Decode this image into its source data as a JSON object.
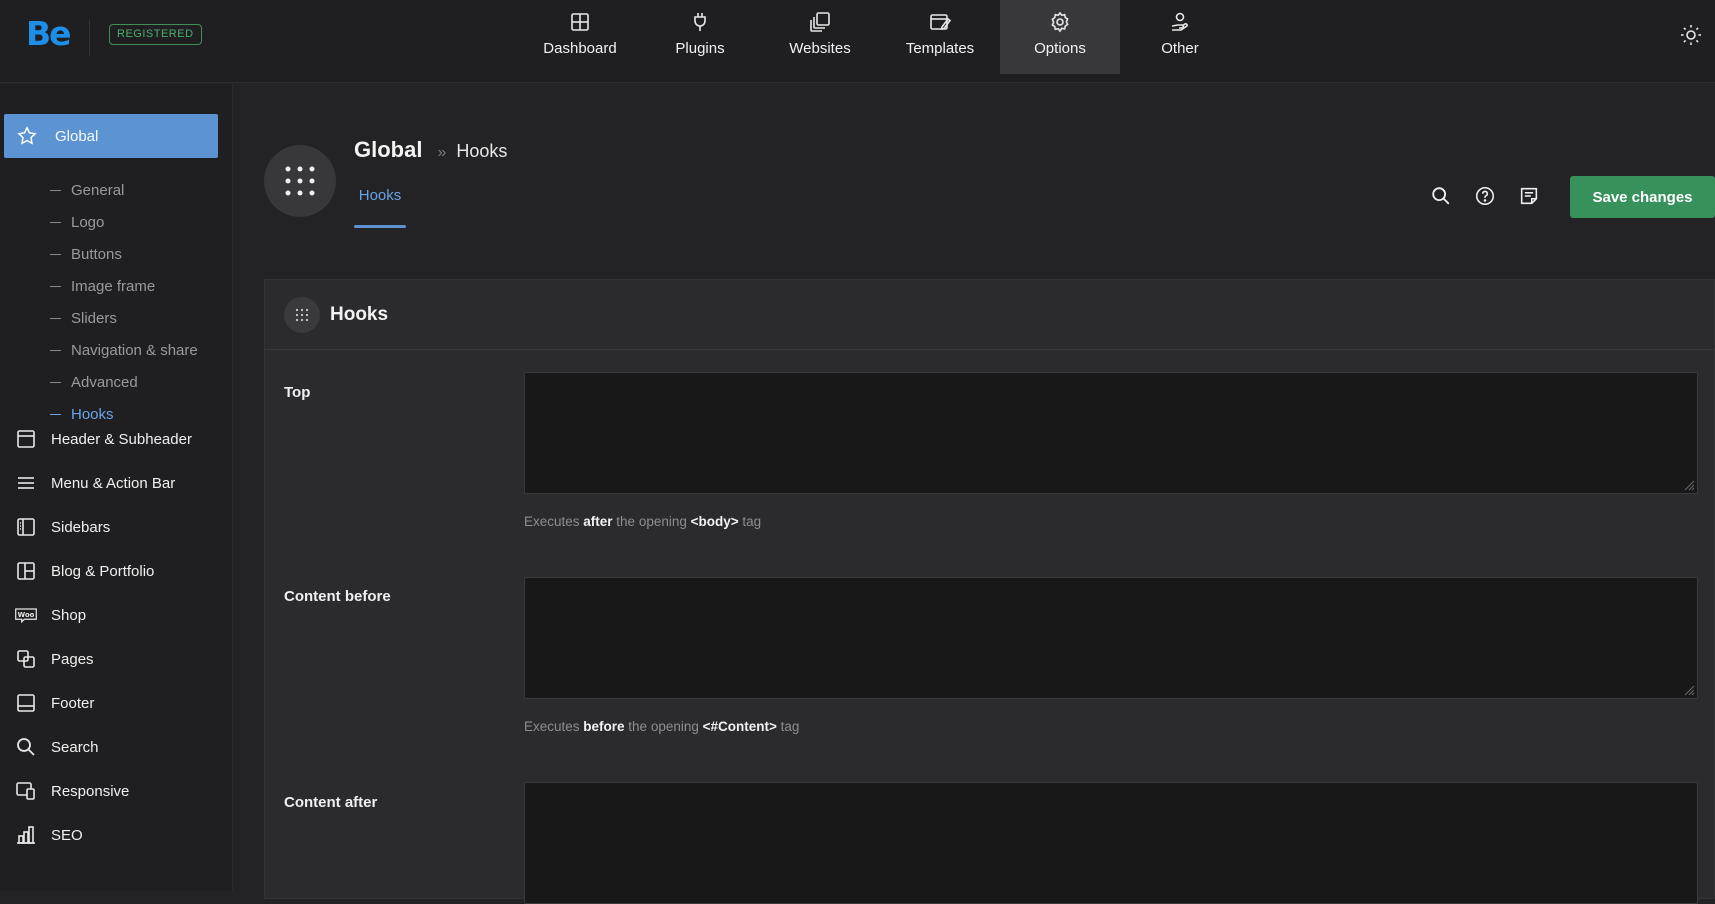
{
  "topbar": {
    "logo": "Be",
    "badge": "REGISTERED",
    "nav": [
      {
        "label": "Dashboard",
        "icon": "dashboard-icon"
      },
      {
        "label": "Plugins",
        "icon": "plug-icon"
      },
      {
        "label": "Websites",
        "icon": "websites-icon"
      },
      {
        "label": "Templates",
        "icon": "templates-icon"
      },
      {
        "label": "Options",
        "icon": "gear-icon",
        "active": true
      },
      {
        "label": "Other",
        "icon": "other-icon"
      }
    ],
    "theme_toggle_icon": "sun-icon"
  },
  "sidebar": {
    "active": {
      "label": "Global",
      "icon": "star-icon"
    },
    "subitems": [
      "General",
      "Logo",
      "Buttons",
      "Image frame",
      "Sliders",
      "Navigation & share",
      "Advanced",
      "Hooks"
    ],
    "current_subitem": "Hooks",
    "items": [
      {
        "label": "Header & Subheader",
        "icon": "header-icon"
      },
      {
        "label": "Menu & Action Bar",
        "icon": "menu-icon"
      },
      {
        "label": "Sidebars",
        "icon": "sidebars-icon"
      },
      {
        "label": "Blog & Portfolio",
        "icon": "blog-icon"
      },
      {
        "label": "Shop",
        "icon": "woo-icon"
      },
      {
        "label": "Pages",
        "icon": "pages-icon"
      },
      {
        "label": "Footer",
        "icon": "footer-icon"
      },
      {
        "label": "Search",
        "icon": "search-icon"
      },
      {
        "label": "Responsive",
        "icon": "responsive-icon"
      },
      {
        "label": "SEO",
        "icon": "seo-icon"
      }
    ]
  },
  "header": {
    "breadcrumb_parent": "Global",
    "breadcrumb_sep": "»",
    "breadcrumb_current": "Hooks",
    "subtab": "Hooks",
    "save_label": "Save changes"
  },
  "panel": {
    "title": "Hooks",
    "fields": [
      {
        "label": "Top",
        "value": "",
        "help_pre": "Executes ",
        "help_bold": "after",
        "help_mid": " the opening ",
        "help_tag": "<body>",
        "help_post": " tag"
      },
      {
        "label": "Content before",
        "value": "",
        "help_pre": "Executes ",
        "help_bold": "before",
        "help_mid": " the opening ",
        "help_tag": "<#Content>",
        "help_post": " tag"
      },
      {
        "label": "Content after",
        "value": ""
      }
    ]
  },
  "colors": {
    "accent": "#5c93d2",
    "save": "#37915a",
    "badge": "#4caf72",
    "logo": "#1e8fe8"
  }
}
